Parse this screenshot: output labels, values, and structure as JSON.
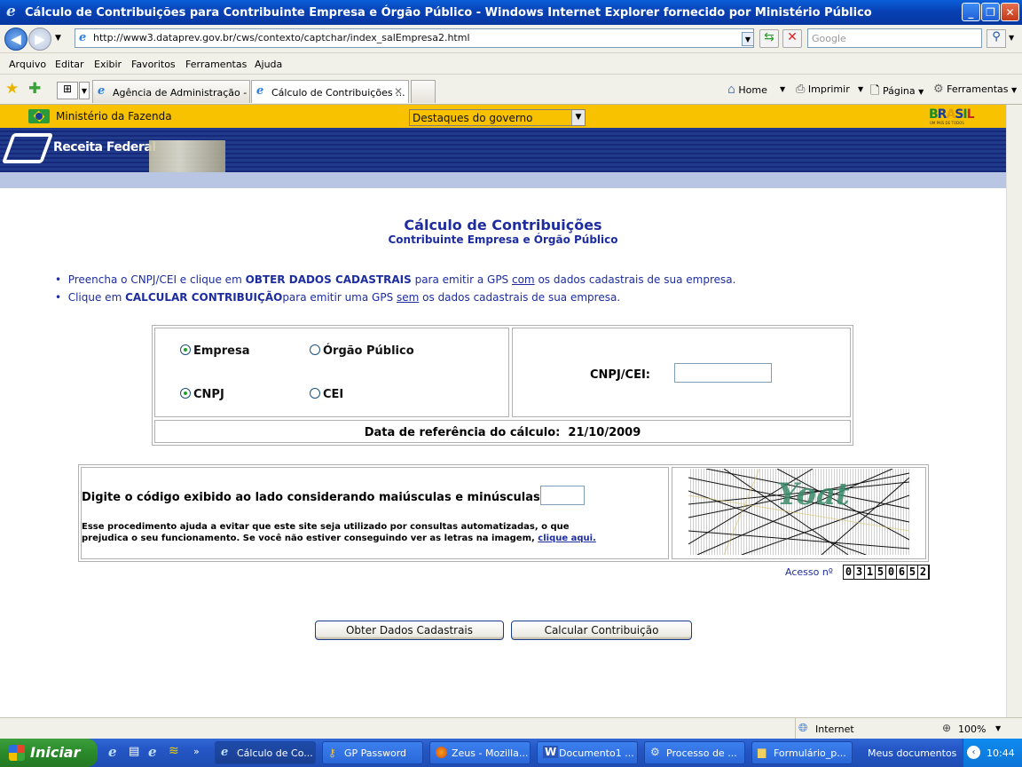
{
  "window": {
    "title": "Cálculo de Contribuições para Contribuinte Empresa e Órgão Público - Windows Internet Explorer fornecido por Ministério Público"
  },
  "address_bar": {
    "url": "http://www3.dataprev.gov.br/cws/contexto/captchar/index_salEmpresa2.html",
    "search_placeholder": "Google"
  },
  "menu": [
    "Arquivo",
    "Editar",
    "Exibir",
    "Favoritos",
    "Ferramentas",
    "Ajuda"
  ],
  "tabs": [
    {
      "label": "Agência de Administração - S..."
    },
    {
      "label": "Cálculo de Contribuições ..."
    }
  ],
  "toolbar": {
    "home": "Home",
    "print": "Imprimir",
    "page": "Página",
    "tools": "Ferramentas"
  },
  "gov_bar": {
    "ministry": "Ministério da Fazenda",
    "select_value": "Destaques do governo",
    "brasil_tagline": "UM PAÍS DE TODOS"
  },
  "banner": {
    "logo_text": "Receita Federal"
  },
  "main": {
    "title": "Cálculo de Contribuições",
    "subtitle": "Contribuinte Empresa e Órgão Público",
    "bullet1": {
      "pre": "Preencha o CNPJ/CEI e clique em ",
      "bold": "OBTER DADOS CADASTRAIS",
      "mid": " para emitir a GPS ",
      "under": "com",
      "post": " os dados cadastrais de sua empresa."
    },
    "bullet2": {
      "pre": "Clique em ",
      "bold": "CALCULAR CONTRIBUIÇÃO",
      "mid": "para emitir uma GPS ",
      "under": "sem",
      "post": " os dados cadastrais de sua empresa."
    },
    "radio_empresa": "Empresa",
    "radio_orgao": "Órgão Público",
    "radio_cnpj": "CNPJ",
    "radio_cei": "CEI",
    "cnpj_label": "CNPJ/CEI:",
    "cnpj_value": "",
    "ref_date_label": "Data de referência do cálculo:",
    "ref_date": "21/10/2009",
    "captcha_label": "Digite o código exibido ao lado considerando maiúsculas e minúsculas:",
    "captcha_value": "",
    "captcha_help": "Esse procedimento ajuda a evitar que este site seja utilizado por consultas automatizadas, o que prejudica o seu funcionamento. Se você não estiver conseguindo ver as letras na imagem,",
    "captcha_link": "clique aqui.",
    "captcha_image_text": "Yoat",
    "access_label": "Acesso nº",
    "access_digits": [
      "0",
      "3",
      "1",
      "5",
      "0",
      "6",
      "5",
      "2"
    ],
    "btn_obter": "Obter Dados Cadastrais",
    "btn_calcular": "Calcular Contribuição"
  },
  "status": {
    "zone": "Internet",
    "zoom": "100%"
  },
  "taskbar": {
    "start": "Iniciar",
    "tasks": [
      {
        "label": "Cálculo de Co..."
      },
      {
        "label": "GP Password"
      },
      {
        "label": "Zeus - Mozilla..."
      },
      {
        "label": "Documento1 ..."
      },
      {
        "label": "Processo de ..."
      },
      {
        "label": "Formulário_p..."
      }
    ],
    "my_docs": "Meus documentos",
    "clock": "10:44"
  }
}
